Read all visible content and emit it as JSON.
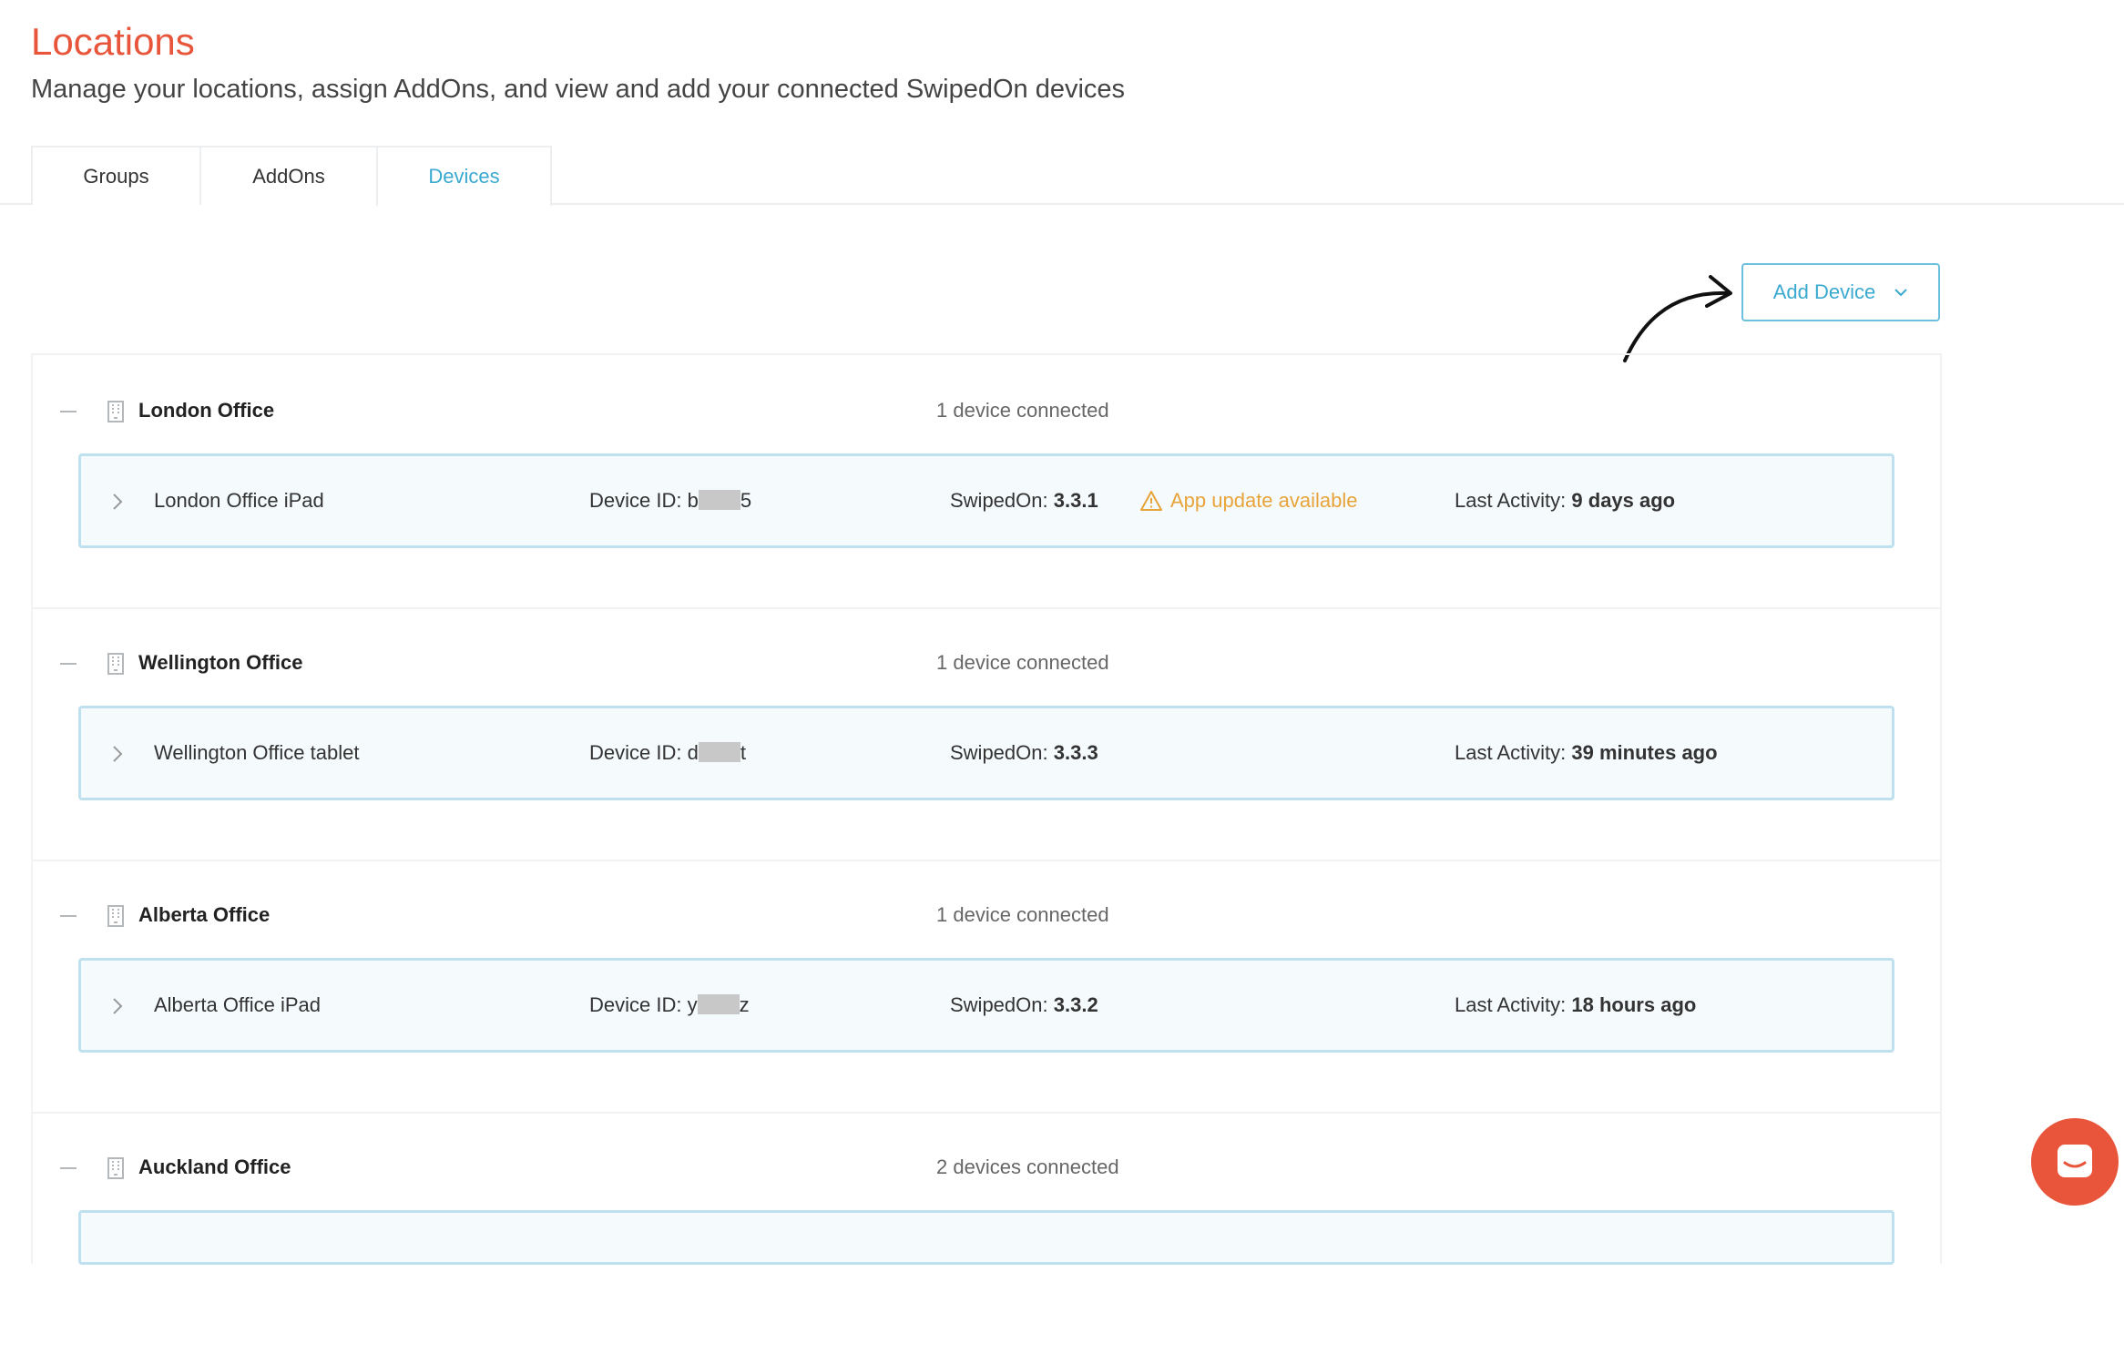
{
  "header": {
    "title": "Locations",
    "subtitle": "Manage your locations, assign AddOns, and view and add your connected SwipedOn devices"
  },
  "tabs": [
    {
      "label": "Groups",
      "active": false
    },
    {
      "label": "AddOns",
      "active": false
    },
    {
      "label": "Devices",
      "active": true
    }
  ],
  "toolbar": {
    "add_device_label": "Add Device"
  },
  "labels": {
    "device_id": "Device ID:",
    "swipedon": "SwipedOn:",
    "last_activity": "Last Activity:",
    "app_update": "App update available"
  },
  "groups": [
    {
      "name": "London Office",
      "count": "1 device connected",
      "device": {
        "name": "London Office iPad",
        "id_start": "b",
        "id_end": "5",
        "version": "3.3.1",
        "update": true,
        "last_activity": "9 days ago"
      }
    },
    {
      "name": "Wellington Office",
      "count": "1 device connected",
      "device": {
        "name": "Wellington Office tablet",
        "id_start": "d",
        "id_end": "t",
        "version": "3.3.3",
        "update": false,
        "last_activity": "39 minutes ago"
      }
    },
    {
      "name": "Alberta Office",
      "count": "1 device connected",
      "device": {
        "name": "Alberta Office iPad",
        "id_start": "y",
        "id_end": "z",
        "version": "3.3.2",
        "update": false,
        "last_activity": "18 hours ago"
      }
    },
    {
      "name": "Auckland Office",
      "count": "2 devices connected"
    }
  ],
  "colors": {
    "accent": "#e8553a",
    "link": "#3aa9d0",
    "warning": "#e8a33a"
  },
  "icons": [
    "collapse-icon",
    "building-icon",
    "chevron-right-icon",
    "chevron-down-icon",
    "warning-icon",
    "chat-icon"
  ]
}
